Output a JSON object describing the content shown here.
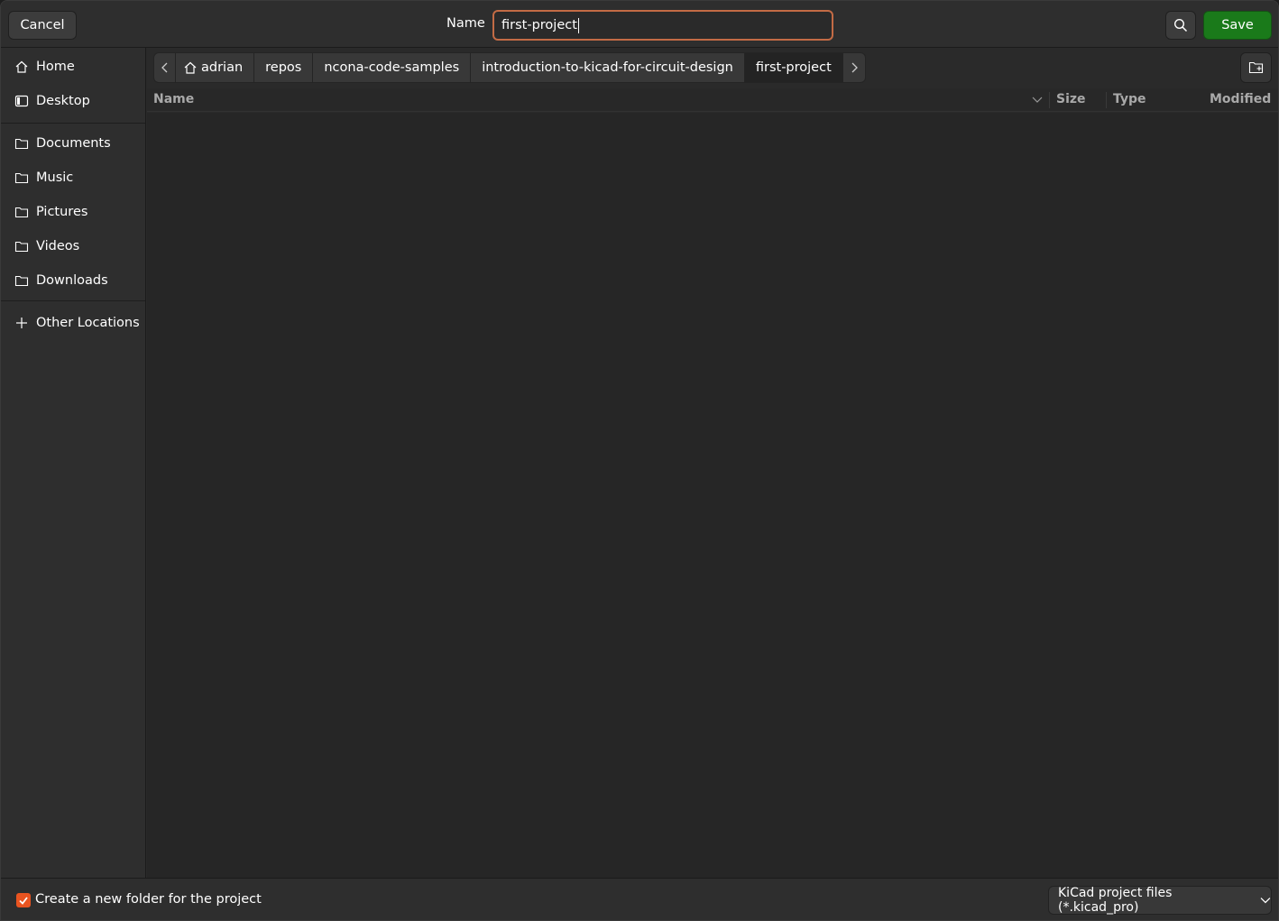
{
  "header": {
    "cancel_label": "Cancel",
    "name_label": "Name",
    "name_value": "first-project",
    "save_label": "Save"
  },
  "sidebar": {
    "items": [
      {
        "label": "Home",
        "icon": "home-icon"
      },
      {
        "label": "Desktop",
        "icon": "desktop-icon"
      },
      {
        "label": "Documents",
        "icon": "folder-icon"
      },
      {
        "label": "Music",
        "icon": "folder-icon"
      },
      {
        "label": "Pictures",
        "icon": "folder-icon"
      },
      {
        "label": "Videos",
        "icon": "folder-icon"
      },
      {
        "label": "Downloads",
        "icon": "folder-icon"
      },
      {
        "label": "Other Locations",
        "icon": "plus-icon"
      }
    ]
  },
  "pathbar": {
    "crumbs": [
      "adrian",
      "repos",
      "ncona-code-samples",
      "introduction-to-kicad-for-circuit-design",
      "first-project"
    ],
    "active_index": 4
  },
  "columns": {
    "name": "Name",
    "size": "Size",
    "type": "Type",
    "modified": "Modified"
  },
  "footer": {
    "checkbox_label": "Create a new folder for the project",
    "checkbox_checked": true,
    "filter_label": "KiCad project files (*.kicad_pro)"
  },
  "colors": {
    "accent": "#e95420",
    "save_button": "#1a7a1a",
    "focus_border": "#c36b45"
  }
}
